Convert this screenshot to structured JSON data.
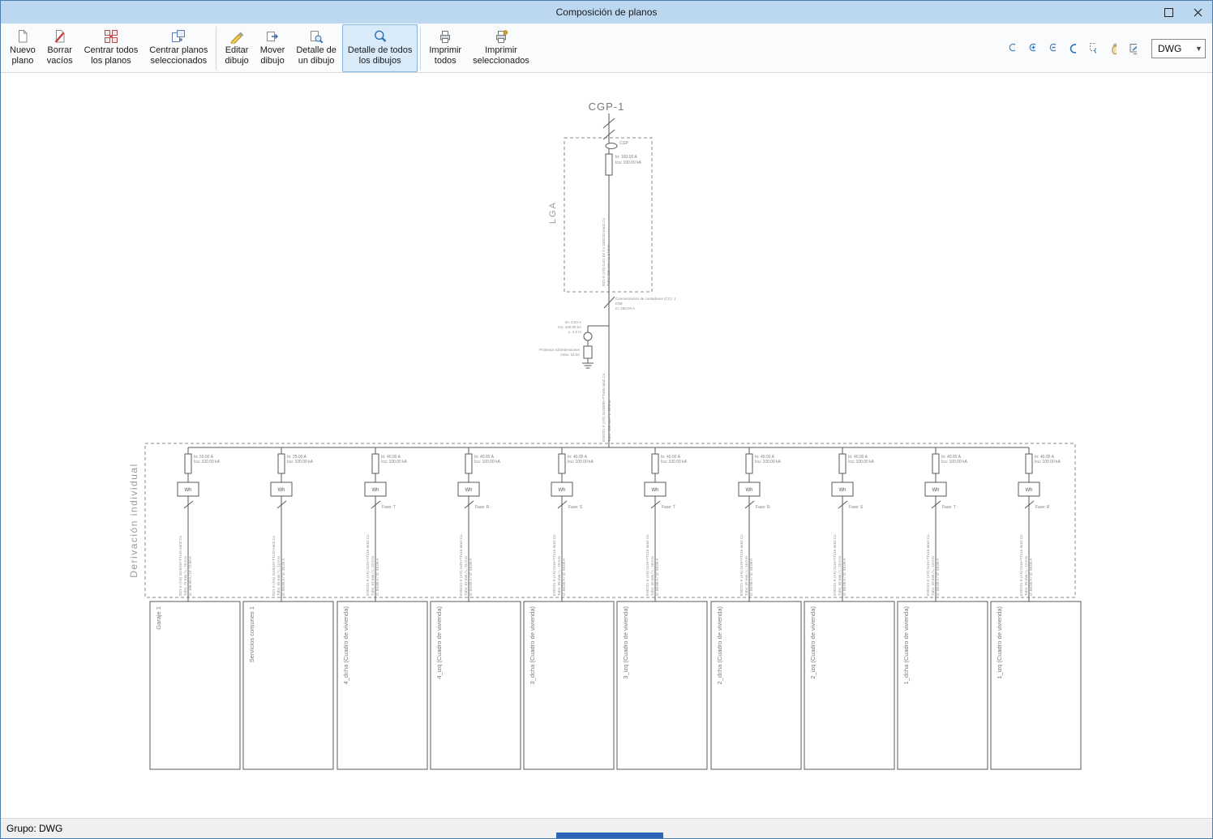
{
  "window": {
    "title": "Composición de planos"
  },
  "toolbar": {
    "buttons": [
      {
        "label": "Nuevo\nplano"
      },
      {
        "label": "Borrar\nvacíos"
      },
      {
        "label": "Centrar todos\nlos planos"
      },
      {
        "label": "Centrar planos\nseleccionados"
      },
      {
        "label": "Editar\ndibujo"
      },
      {
        "label": "Mover\ndibujo"
      },
      {
        "label": "Detalle de\nun dibujo"
      },
      {
        "label": "Detalle de todos\nlos dibujos"
      },
      {
        "label": "Imprimir\ntodos"
      },
      {
        "label": "Imprimir\nseleccionados"
      }
    ],
    "format_selector": {
      "value": "DWG"
    }
  },
  "diagram": {
    "cgp_label": "CGP-1",
    "cgp_tag": "CGP",
    "lga_label": "LGA",
    "derivacion_label": "Derivación individual",
    "meter_label": "Wh",
    "lga_fuse": [
      "In: 160.00 A",
      "Icu: 100.00 kA"
    ],
    "lga_cable": [
      "RZ1-K (AS) 0.6/1 kV 3 x 240/120 mm2 Cu",
      "Tubo: 225 mm / L: 14.0 m"
    ],
    "cc_lines": [
      "Concentración de contadores (CC): 1",
      "IGM",
      "In: 250.00 A"
    ],
    "meter_lines": [
      "Im: 0.63 A",
      "Icu: 100.00 kA",
      "L: 2.0 m"
    ],
    "spd_lines": [
      "Protector sobretensiones",
      "Imáx: 10 kA"
    ],
    "main_cable": [
      "ES07Z1-K (AS) 3x150/95+TTx95 mm2 Cu",
      "Tubo: 160 mm / L: 20.0 m"
    ],
    "branches": [
      {
        "fuse": [
          "In: 50.00 A",
          "Icu: 100.00 kA"
        ],
        "phase": "",
        "cable": [
          "RZ1-K (AS) 3x25/16+TTx16 mm2 Cu",
          "Tubo: 75 mm / L: 15.0 m",
          "Iz: 106.00 A / I2: 72.50 A"
        ],
        "box_label": "Garaje 1"
      },
      {
        "fuse": [
          "In: 25.00 A",
          "Icu: 100.00 kA"
        ],
        "phase": "",
        "cable": [
          "RZ1-K (AS) 3x10/10+TTx10 mm2 Cu",
          "Tubo: 50 mm / L: 12.0 m",
          "Iz: 60.00 A / I2: 36.25 A"
        ],
        "box_label": "Servicios comunes 1"
      },
      {
        "fuse": [
          "In: 40.00 A",
          "Icu: 100.00 kA"
        ],
        "phase": "Fase: T",
        "cable": [
          "ES07Z1-K (AS) 2x25+TTx16 mm2 Cu",
          "Tubo: 63 mm / L: 22.0 m",
          "Iz: 84.00 A / I2: 58.00 A"
        ],
        "box_label": "4_dcha (Cuadro de vivienda)"
      },
      {
        "fuse": [
          "In: 40.00 A",
          "Icu: 100.00 kA"
        ],
        "phase": "Fase: R",
        "cable": [
          "ES07Z1-K (AS) 2x25+TTx16 mm2 Cu",
          "Tubo: 63 mm / L: 21.0 m",
          "Iz: 84.00 A / I2: 58.00 A"
        ],
        "box_label": "4_izq (Cuadro de vivienda)"
      },
      {
        "fuse": [
          "In: 40.00 A",
          "Icu: 100.00 kA"
        ],
        "phase": "Fase: S",
        "cable": [
          "ES07Z1-K (AS) 2x16+TTx16 mm2 Cu",
          "Tubo: 50 mm / L: 19.0 m",
          "Iz: 66.00 A / I2: 58.00 A"
        ],
        "box_label": "3_dcha (Cuadro de vivienda)"
      },
      {
        "fuse": [
          "In: 40.00 A",
          "Icu: 100.00 kA"
        ],
        "phase": "Fase: T",
        "cable": [
          "ES07Z1-K (AS) 2x16+TTx16 mm2 Cu",
          "Tubo: 50 mm / L: 18.0 m",
          "Iz: 66.00 A / I2: 58.00 A"
        ],
        "box_label": "3_izq (Cuadro de vivienda)"
      },
      {
        "fuse": [
          "In: 40.00 A",
          "Icu: 100.00 kA"
        ],
        "phase": "Fase: R",
        "cable": [
          "ES07Z1-K (AS) 2x16+TTx16 mm2 Cu",
          "Tubo: 50 mm / L: 16.0 m",
          "Iz: 66.00 A / I2: 58.00 A"
        ],
        "box_label": "2_dcha (Cuadro de vivienda)"
      },
      {
        "fuse": [
          "In: 40.00 A",
          "Icu: 100.00 kA"
        ],
        "phase": "Fase: S",
        "cable": [
          "ES07Z1-K (AS) 2x16+TTx16 mm2 Cu",
          "Tubo: 50 mm / L: 15.0 m",
          "Iz: 66.00 A / I2: 58.00 A"
        ],
        "box_label": "2_izq (Cuadro de vivienda)"
      },
      {
        "fuse": [
          "In: 40.00 A",
          "Icu: 100.00 kA"
        ],
        "phase": "Fase: T",
        "cable": [
          "ES07Z1-K (AS) 2x16+TTx16 mm2 Cu",
          "Tubo: 50 mm / L: 13.0 m",
          "Iz: 66.00 A / I2: 58.00 A"
        ],
        "box_label": "1_dcha (Cuadro de vivienda)"
      },
      {
        "fuse": [
          "In: 40.00 A",
          "Icu: 100.00 kA"
        ],
        "phase": "Fase: R",
        "cable": [
          "ES07Z1-K (AS) 2x16+TTx16 mm2 Cu",
          "Tubo: 50 mm / L: 12.0 m",
          "Iz: 66.00 A / I2: 58.00 A"
        ],
        "box_label": "1_izq (Cuadro de vivienda)"
      }
    ]
  },
  "statusbar": {
    "text": "Grupo: DWG"
  }
}
